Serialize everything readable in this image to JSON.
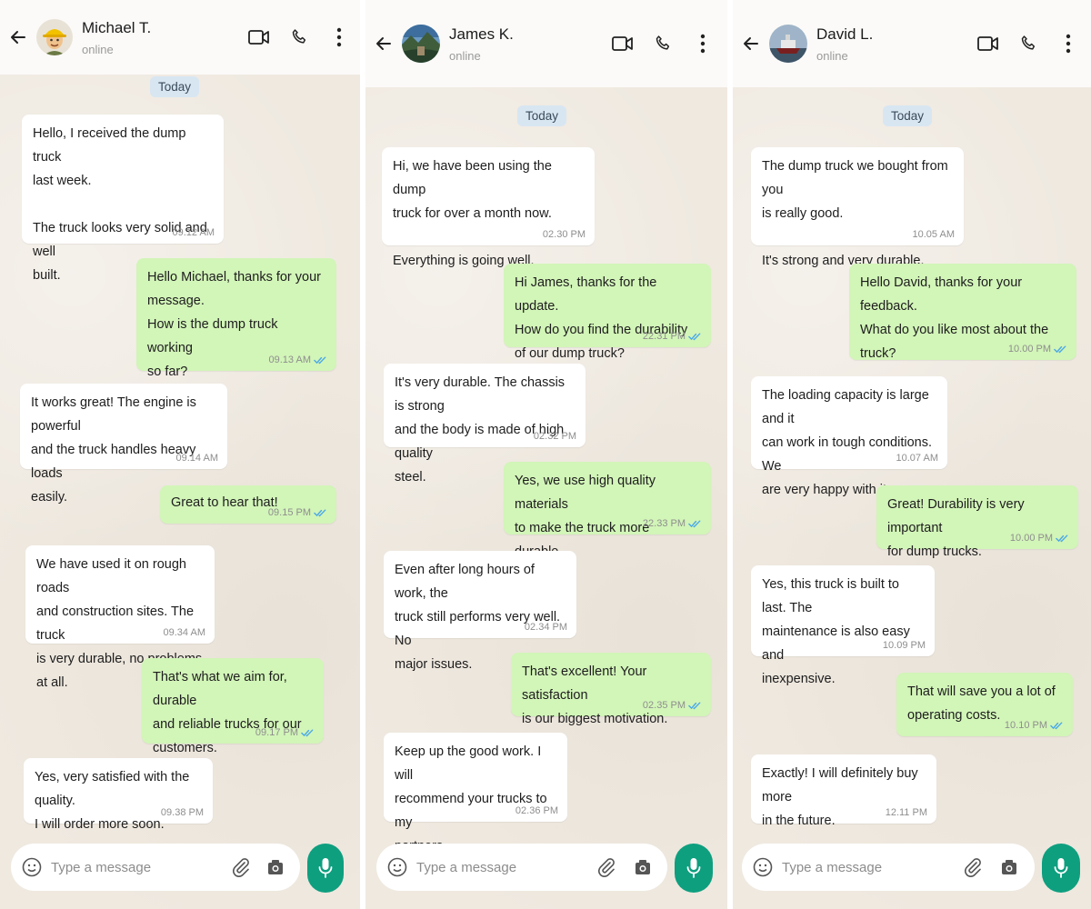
{
  "composer_placeholder": "Type a message",
  "colors": {
    "incoming_bubble": "#ffffff",
    "outgoing_bubble": "#d2f5b8",
    "date_pill": "#d8e6f2",
    "mic_button": "#0e9f7f",
    "read_ticks": "#4aa8e8"
  },
  "chats": [
    {
      "contact": {
        "name": "Michael T.",
        "status": "online",
        "avatar": "worker-hardhat-avatar"
      },
      "date_label": "Today",
      "messages": [
        {
          "dir": "in",
          "text": "Hello, I received the dump truck\nlast week.\n\nThe truck looks very solid and well\nbuilt.",
          "time": "09.12 AM",
          "read": false
        },
        {
          "dir": "out",
          "text": "Hello Michael, thanks for your\nmessage.\nHow is the dump truck working\nso far?",
          "time": "09.13 AM",
          "read": true
        },
        {
          "dir": "in",
          "text": "It works great! The engine is powerful\nand the truck handles heavy loads\neasily.",
          "time": "09.14 AM",
          "read": false
        },
        {
          "dir": "out",
          "text": "Great to hear that!",
          "time": "09.15 PM",
          "read": true
        },
        {
          "dir": "in",
          "text": "We have used it on rough roads\nand construction sites. The truck\nis very durable, no problems at all.",
          "time": "09.34 AM",
          "read": false
        },
        {
          "dir": "out",
          "text": "That's what we aim for, durable\nand reliable trucks for our\ncustomers.",
          "time": "09.17 PM",
          "read": true
        },
        {
          "dir": "in",
          "text": "Yes, very satisfied with the quality.\nI will order more soon.",
          "time": "09.38 PM",
          "read": false
        }
      ]
    },
    {
      "contact": {
        "name": "James K.",
        "status": "online",
        "avatar": "landscape-avatar"
      },
      "date_label": "Today",
      "messages": [
        {
          "dir": "in",
          "text": "Hi, we have been using the dump\ntruck for over a month now.\n\nEverything is going well.",
          "time": "02.30 PM",
          "read": false
        },
        {
          "dir": "out",
          "text": "Hi James, thanks for the update.\nHow do you find the durability\nof our dump truck?",
          "time": "22.31 PM",
          "read": true
        },
        {
          "dir": "in",
          "text": "It's very durable. The chassis is strong\nand the body is made of high quality\nsteel.",
          "time": "02.32 PM",
          "read": false
        },
        {
          "dir": "out",
          "text": "Yes, we use high quality materials\nto make the truck more durable.",
          "time": "22.33 PM",
          "read": true
        },
        {
          "dir": "in",
          "text": "Even after long hours of work, the\ntruck still performs very well. No\nmajor issues.",
          "time": "02.34 PM",
          "read": false
        },
        {
          "dir": "out",
          "text": "That's excellent! Your satisfaction\nis our biggest motivation.",
          "time": "02.35 PM",
          "read": true
        },
        {
          "dir": "in",
          "text": "Keep up the good work. I will\nrecommend your trucks to my\npartners.",
          "time": "02.36 PM",
          "read": false
        }
      ]
    },
    {
      "contact": {
        "name": "David L.",
        "status": "online",
        "avatar": "ship-avatar"
      },
      "date_label": "Today",
      "messages": [
        {
          "dir": "in",
          "text": "The dump truck we bought from you\nis really good.\n\nIt's strong and very durable.",
          "time": "10.05 AM",
          "read": false
        },
        {
          "dir": "out",
          "text": "Hello David, thanks for your feedback.\nWhat do you like most about the\ntruck?",
          "time": "10.00 PM",
          "read": true
        },
        {
          "dir": "in",
          "text": "The loading capacity is large and it\ncan work in tough conditions. We\nare very happy with it.",
          "time": "10.07 AM",
          "read": false
        },
        {
          "dir": "out",
          "text": "Great! Durability is very important\nfor dump trucks.",
          "time": "10.00 PM",
          "read": true
        },
        {
          "dir": "in",
          "text": "Yes, this truck is built to last. The\nmaintenance is also easy and\ninexpensive.",
          "time": "10.09 PM",
          "read": false
        },
        {
          "dir": "out",
          "text": "That will save you a lot of\noperating costs.",
          "time": "10.10 PM",
          "read": true
        },
        {
          "dir": "in",
          "text": "Exactly! I will definitely buy more\nin the future.",
          "time": "12.11 PM",
          "read": false
        }
      ]
    }
  ]
}
